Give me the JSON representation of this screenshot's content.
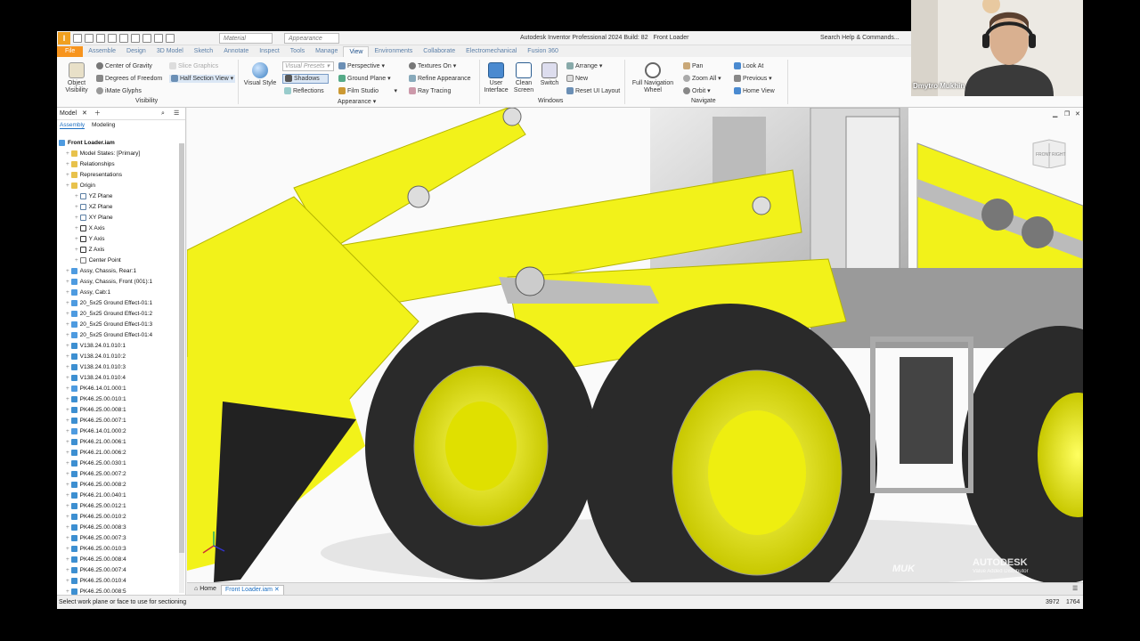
{
  "title_bar": {
    "app_title": "Autodesk Inventor Professional 2024 Build: 82",
    "document_title": "Front Loader",
    "material_combo": "Material",
    "appearance_combo": "Appearance",
    "search_placeholder": "Search Help & Commands..."
  },
  "tabs": [
    "File",
    "Assemble",
    "Design",
    "3D Model",
    "Sketch",
    "Annotate",
    "Inspect",
    "Tools",
    "Manage",
    "View",
    "Environments",
    "Collaborate",
    "Electromechanical",
    "Fusion 360"
  ],
  "active_tab": "View",
  "ribbon": {
    "visibility": {
      "object_visibility": "Object Visibility",
      "center_of_gravity": "Center of Gravity",
      "degrees_of_freedom": "Degrees of Freedom",
      "imate_glyphs": "iMate Glyphs",
      "slice_graphics": "Slice Graphics",
      "half_section_view": "Half Section View",
      "panel": "Visibility"
    },
    "appearance": {
      "visual_style": "Visual Style",
      "visual_presets": "Visual Presets",
      "shadows": "Shadows",
      "reflections": "Reflections",
      "perspective": "Perspective",
      "ground_plane": "Ground Plane",
      "film_studio": "Film Studio",
      "textures_on": "Textures On",
      "refine_appearance": "Refine Appearance",
      "ray_tracing": "Ray Tracing",
      "panel": "Appearance"
    },
    "windows": {
      "user_interface": "User Interface",
      "clean_screen": "Clean Screen",
      "switch": "Switch",
      "arrange": "Arrange",
      "new": "New",
      "reset_ui_layout": "Reset UI Layout",
      "panel": "Windows"
    },
    "navigate": {
      "full_navigation_wheel": "Full Navigation Wheel",
      "pan": "Pan",
      "zoom_all": "Zoom All",
      "orbit": "Orbit",
      "look_at": "Look At",
      "previous": "Previous",
      "home_view": "Home View",
      "panel": "Navigate"
    }
  },
  "browser": {
    "title": "Model",
    "subtabs": [
      "Assembly",
      "Modeling"
    ],
    "root": "Front Loader.iam",
    "items": [
      {
        "label": "Model States: [Primary]",
        "icon": "folder",
        "indent": 1
      },
      {
        "label": "Relationships",
        "icon": "folder",
        "indent": 1
      },
      {
        "label": "Representations",
        "icon": "folder",
        "indent": 1
      },
      {
        "label": "Origin",
        "icon": "folder",
        "indent": 1
      },
      {
        "label": "YZ Plane",
        "icon": "plane",
        "indent": 2
      },
      {
        "label": "XZ Plane",
        "icon": "plane",
        "indent": 2
      },
      {
        "label": "XY Plane",
        "icon": "plane",
        "indent": 2
      },
      {
        "label": "X Axis",
        "icon": "axis",
        "indent": 2
      },
      {
        "label": "Y Axis",
        "icon": "axis",
        "indent": 2
      },
      {
        "label": "Z Axis",
        "icon": "axis",
        "indent": 2
      },
      {
        "label": "Center Point",
        "icon": "point",
        "indent": 2
      },
      {
        "label": "Assy, Chassis, Rear:1",
        "icon": "asm",
        "indent": 1
      },
      {
        "label": "Assy, Chassis, Front (001):1",
        "icon": "asm",
        "indent": 1
      },
      {
        "label": "Assy, Cab:1",
        "icon": "asm",
        "indent": 1
      },
      {
        "label": "20_5x25 Ground Effect-01:1",
        "icon": "asm",
        "indent": 1
      },
      {
        "label": "20_5x25 Ground Effect-01:2",
        "icon": "asm",
        "indent": 1
      },
      {
        "label": "20_5x25 Ground Effect-01:3",
        "icon": "asm",
        "indent": 1
      },
      {
        "label": "20_5x25 Ground Effect-01:4",
        "icon": "asm",
        "indent": 1
      },
      {
        "label": "V138.24.01.010:1",
        "icon": "part",
        "indent": 1
      },
      {
        "label": "V138.24.01.010:2",
        "icon": "part",
        "indent": 1
      },
      {
        "label": "V138.24.01.010:3",
        "icon": "part",
        "indent": 1
      },
      {
        "label": "V138.24.01.010:4",
        "icon": "part",
        "indent": 1
      },
      {
        "label": "PK46.14.01.000:1",
        "icon": "asm",
        "indent": 1
      },
      {
        "label": "PK46.25.00.010:1",
        "icon": "part",
        "indent": 1
      },
      {
        "label": "PK46.25.00.008:1",
        "icon": "part",
        "indent": 1
      },
      {
        "label": "PK46.25.00.007:1",
        "icon": "part",
        "indent": 1
      },
      {
        "label": "PK46.14.01.000:2",
        "icon": "asm",
        "indent": 1
      },
      {
        "label": "PK46.21.00.006:1",
        "icon": "part",
        "indent": 1
      },
      {
        "label": "PK46.21.00.006:2",
        "icon": "part",
        "indent": 1
      },
      {
        "label": "PK46.25.00.030:1",
        "icon": "part",
        "indent": 1
      },
      {
        "label": "PK46.25.00.007:2",
        "icon": "part",
        "indent": 1
      },
      {
        "label": "PK46.25.00.008:2",
        "icon": "part",
        "indent": 1
      },
      {
        "label": "PK46.21.00.040:1",
        "icon": "part",
        "indent": 1
      },
      {
        "label": "PK46.25.00.012:1",
        "icon": "part",
        "indent": 1
      },
      {
        "label": "PK46.25.00.010:2",
        "icon": "part",
        "indent": 1
      },
      {
        "label": "PK46.25.00.008:3",
        "icon": "part",
        "indent": 1
      },
      {
        "label": "PK46.25.00.007:3",
        "icon": "part",
        "indent": 1
      },
      {
        "label": "PK46.25.00.010:3",
        "icon": "part",
        "indent": 1
      },
      {
        "label": "PK46.25.00.008:4",
        "icon": "part",
        "indent": 1
      },
      {
        "label": "PK46.25.00.007:4",
        "icon": "part",
        "indent": 1
      },
      {
        "label": "PK46.25.00.010:4",
        "icon": "part",
        "indent": 1
      },
      {
        "label": "PK46.25.00.008:5",
        "icon": "part",
        "indent": 1
      }
    ]
  },
  "doc_tabs": {
    "home": "Home",
    "document": "Front Loader.iam"
  },
  "status": {
    "message": "Select work plane or face to use for sectioning",
    "x": "3972",
    "y": "1764"
  },
  "viewcube": {
    "front": "FRONT",
    "right": "RIGHT"
  },
  "webcam": {
    "name": "Dmytro Mukhin"
  },
  "watermarks": {
    "muk": "MUK",
    "autodesk": "AUTODESK",
    "subtitle": "Value Added Distributor"
  },
  "colors": {
    "accent": "#f7941d",
    "loader_yellow": "#f2f21a",
    "tire": "#2a2a2a"
  }
}
